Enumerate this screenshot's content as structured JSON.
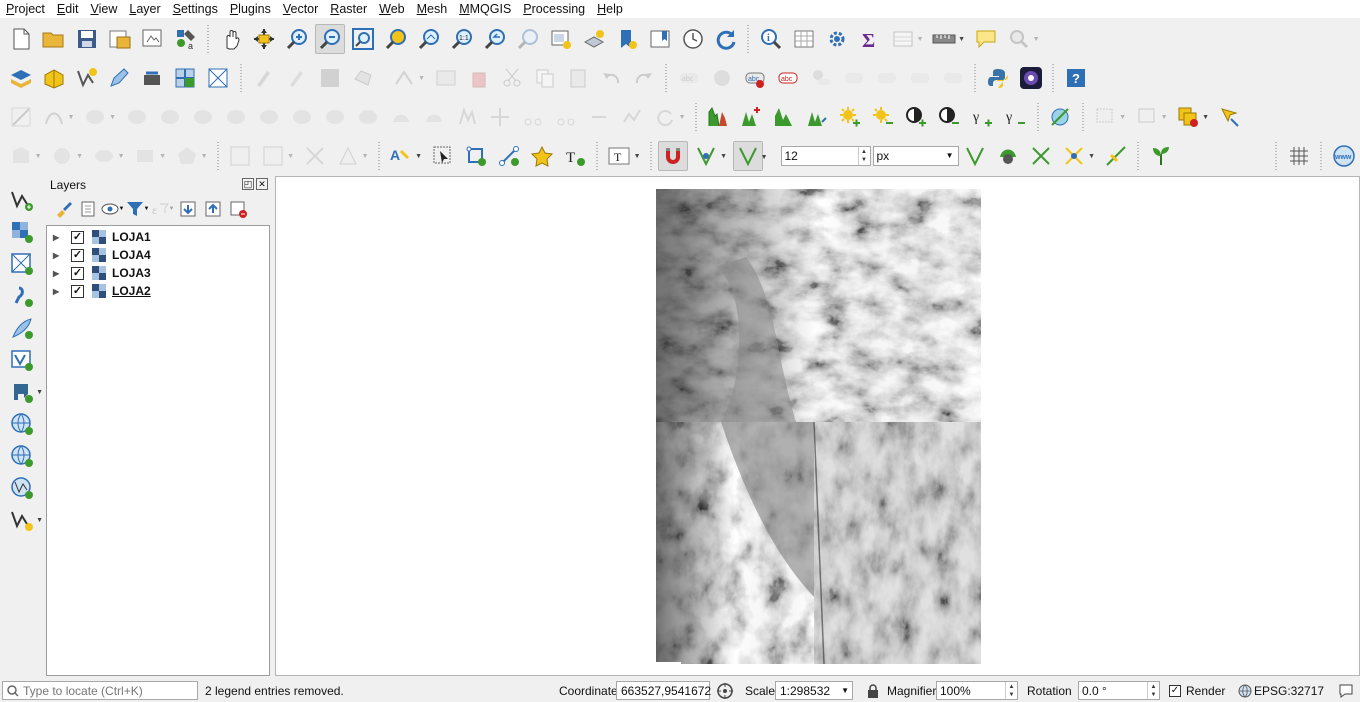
{
  "menu": [
    "Project",
    "Edit",
    "View",
    "Layer",
    "Settings",
    "Plugins",
    "Vector",
    "Raster",
    "Web",
    "Mesh",
    "MMQGIS",
    "Processing",
    "Help"
  ],
  "digitizing": {
    "font_size": "12",
    "unit": "px"
  },
  "layers_panel": {
    "title": "Layers",
    "items": [
      {
        "name": "LOJA1",
        "checked": true
      },
      {
        "name": "LOJA4",
        "checked": true
      },
      {
        "name": "LOJA3",
        "checked": true
      },
      {
        "name": "LOJA2",
        "checked": true
      }
    ]
  },
  "status": {
    "locator_placeholder": "Type to locate (Ctrl+K)",
    "message": "2 legend entries removed.",
    "coordinate_label": "Coordinate",
    "coordinate_value": "663527,9541672",
    "scale_label": "Scale",
    "scale_value": "1:298532",
    "magnifier_label": "Magnifier",
    "magnifier_value": "100%",
    "rotation_label": "Rotation",
    "rotation_value": "0.0 °",
    "render_label": "Render",
    "render_checked": true,
    "crs": "EPSG:32717"
  },
  "colors": {
    "accent_blue": "#2f6fb5",
    "green_plus": "#3c9a2d",
    "yellow": "#f2c318"
  }
}
